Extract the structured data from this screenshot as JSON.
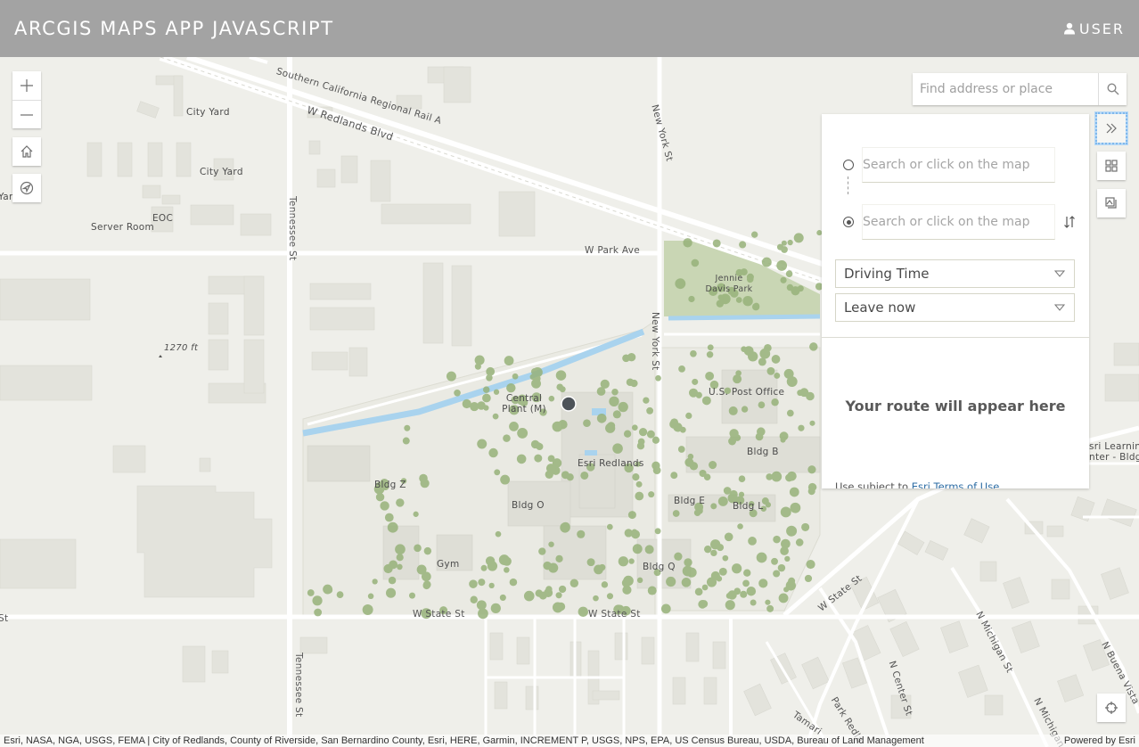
{
  "header": {
    "title": "ARCGIS MAPS APP JAVASCRIPT",
    "user_label": "USER"
  },
  "map_controls": {
    "zoom_in": "zoom-in",
    "zoom_out": "zoom-out",
    "home": "home",
    "locate": "locate",
    "track": "track-location"
  },
  "search": {
    "placeholder": "Find address or place",
    "value": ""
  },
  "directions": {
    "origin_placeholder": "Search or click on the map",
    "destination_placeholder": "Search or click on the map",
    "travel_mode": "Driving Time",
    "depart_time": "Leave now",
    "route_placeholder": "Your route will appear here",
    "terms_prefix": "Use subject to ",
    "terms_link": "Esri Terms of Use"
  },
  "right_toolbar": {
    "items": [
      "collapse-panel",
      "basemap-gallery",
      "layer-list"
    ]
  },
  "map_labels": {
    "rail": "Southern California Regional Rail A",
    "w_redlands_blvd": "W Redlands Blvd",
    "city_yard_1": "City Yard",
    "city_yard_2": "City Yard",
    "eoc": "EOC",
    "server_room": "Server Room",
    "yard_partial": "Yar",
    "tennessee_st_1": "Tennessee St",
    "tennessee_st_2": "Tennessee St",
    "new_york_st_1": "New York St",
    "new_york_st_2": "New York St",
    "w_park_ave": "W Park Ave",
    "jennie_davis_park": "Jennie Davis Park",
    "elevation": "1270 ft",
    "central_plant": "Central Plant (M)",
    "us_post_office": "U.S. Post Office",
    "esri_redlands": "Esri Redlands",
    "bldg_b": "Bldg B",
    "bldg_z": "Bldg Z",
    "bldg_o": "Bldg O",
    "bldg_e": "Bldg E",
    "bldg_l": "Bldg L",
    "gym": "Gym",
    "bldg_q": "Bldg Q",
    "w_state_st_1": "W State St",
    "w_state_st_2": "W State St",
    "w_state_st_3": "W State St",
    "state_st_partial": "St",
    "esri_learning_center": "sri Learning\nnter - Bldg",
    "n_michigan_st_1": "N Michigan St",
    "n_michigan_st_2": "N Michigan",
    "n_center_st": "N Center St",
    "park_redlands": "Park Redla",
    "tamarind": "Tamari",
    "n_buena_vista": "N Buena Vista"
  },
  "attribution": {
    "sources": "Esri, NASA, NGA, USGS, FEMA | City of Redlands, County of Riverside, San Bernardino County, Esri, HERE, Garmin, INCREMENT P, USGS, NPS, EPA, US Census Bureau, USDA, Bureau of Land Management",
    "powered_by": "Powered by Esri"
  },
  "colors": {
    "header_bg": "#a3a3a3",
    "map_bg": "#efefea",
    "water": "#a9d3ee",
    "park": "#c9d6b4",
    "tree": "#97b27a",
    "building": "#e3e3dc",
    "focus_ring": "#7fb8ec",
    "link": "#2e6da4"
  }
}
